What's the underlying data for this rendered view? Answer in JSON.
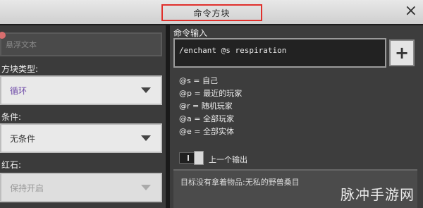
{
  "window": {
    "title": "命令方块",
    "close_glyph": "×"
  },
  "left": {
    "name_placeholder": "悬浮文本",
    "block_type_label": "方块类型:",
    "block_type_value": "循环",
    "condition_label": "条件:",
    "condition_value": "无条件",
    "redstone_label": "红石:",
    "redstone_value": "保持开启"
  },
  "right": {
    "command_label": "命令输入",
    "command_value": "/enchant @s respiration",
    "add_button": "+",
    "selectors": [
      "@s = 自己",
      "@p = 最近的玩家",
      "@r = 随机玩家",
      "@a = 全部玩家",
      "@e = 全部实体"
    ],
    "previous_output_label": "上一个输出",
    "output_text": "目标没有拿着物品:无私的野兽桑目"
  },
  "watermark": "脉冲手游网"
}
